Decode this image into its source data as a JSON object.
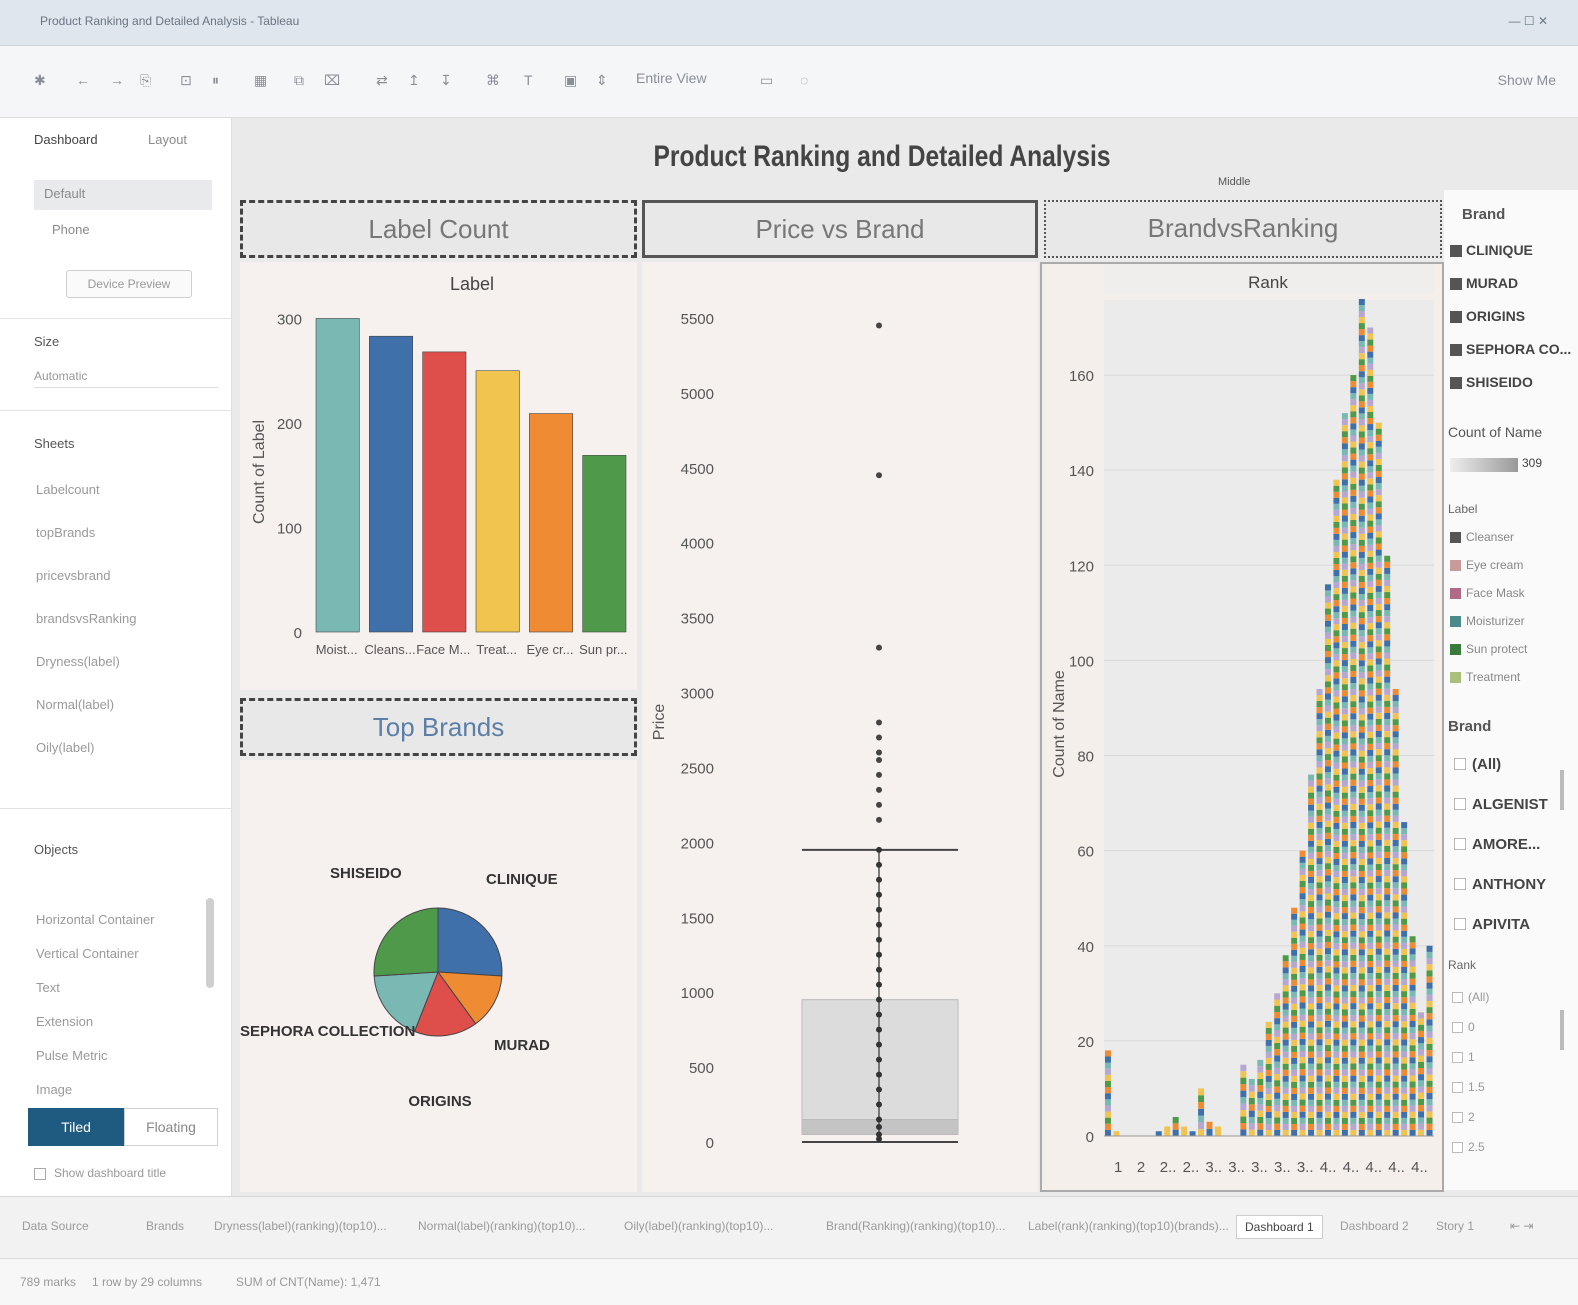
{
  "window": {
    "title": "Product Ranking and Detailed Analysis - Tableau",
    "controls": "— ☐ ✕"
  },
  "toolbar": {
    "icons": [
      "tableau-logo",
      "undo",
      "redo",
      "save",
      "new-data-source",
      "pause",
      "new-sheet",
      "duplicate",
      "clear",
      "swap",
      "sort-asc",
      "sort-desc",
      "group",
      "label",
      "format",
      "fit",
      "present"
    ],
    "fit_view": "Entire View",
    "show_me": "Show Me"
  },
  "left_pane": {
    "tabs": [
      "Dashboard",
      "Layout"
    ],
    "device_items": [
      "Default",
      "Phone"
    ],
    "device_preview": "Device Preview",
    "size_label": "Size",
    "size_value": "Automatic",
    "sheets_label": "Sheets",
    "sheets": [
      "Labelcount",
      "topBrands",
      "pricevsbrand",
      "brandsvsRanking",
      "Dryness(label)",
      "Normal(label)",
      "Oily(label)"
    ],
    "objects_label": "Objects",
    "objects": [
      "Horizontal Container",
      "Vertical Container",
      "Text",
      "Extension",
      "Pulse Metric",
      "Image"
    ],
    "layout_tiled": "Tiled",
    "layout_floating": "Floating",
    "show_title": "Show dashboard title"
  },
  "dashboard": {
    "title": "Product Ranking and Detailed Analysis",
    "label_count_header": "Label Count",
    "price_brand_header": "Price vs Brand",
    "brands_rank_header": "BrandvsRanking",
    "top_brands_header": "Top Brands",
    "brands_rank_small": "Middle"
  },
  "chart_data": [
    {
      "type": "bar",
      "title": "Label",
      "ylabel": "Count of Label",
      "ylim": [
        0,
        310
      ],
      "yticks": [
        "0",
        "100",
        "200",
        "300"
      ],
      "categories": [
        "Moist...",
        "Cleans...",
        "Face M...",
        "Treat...",
        "Eye cr...",
        "Sun pr..."
      ],
      "values": [
        300,
        283,
        268,
        250,
        209,
        169
      ],
      "colors": [
        "#7ab8b4",
        "#3f70aa",
        "#de4e4b",
        "#f1c44f",
        "#ef8b33",
        "#4f9a4a"
      ]
    },
    {
      "type": "pie",
      "title": "Top Brands",
      "categories": [
        "CLINIQUE",
        "MURAD",
        "ORIGINS",
        "SEPHORA COLLECTION",
        "SHISEIDO"
      ],
      "values": [
        26,
        14,
        16,
        18,
        26
      ],
      "colors": [
        "#3f70aa",
        "#ef8b33",
        "#de4e4b",
        "#7ab8b4",
        "#4f9a4a"
      ]
    },
    {
      "type": "scatter",
      "title": "Price vs Brand",
      "ylabel": "Price",
      "ylim": [
        0,
        5700
      ],
      "yticks": [
        "0",
        "500",
        "1000",
        "1500",
        "2000",
        "2500",
        "3000",
        "3500",
        "4000",
        "4500",
        "5000",
        "5500"
      ],
      "box": {
        "q1": 50,
        "median": 150,
        "q3": 950,
        "whisker_low": 0,
        "whisker_high": 1950
      },
      "outliers": [
        5450,
        4450,
        3300,
        2800,
        2700,
        2600,
        2550,
        2450,
        2350,
        2250,
        2150
      ],
      "dense": [
        1950,
        1850,
        1750,
        1650,
        1550,
        1450,
        1350,
        1250,
        1150,
        1050,
        950,
        850,
        750,
        650,
        550,
        450,
        350,
        250,
        150,
        100,
        50,
        20
      ]
    },
    {
      "type": "bar",
      "title": "Rank",
      "ylabel": "Count of Name",
      "ylim": [
        0,
        172
      ],
      "yticks": [
        "0",
        "20",
        "40",
        "60",
        "80",
        "100",
        "120",
        "140",
        "160",
        "180"
      ],
      "xticks": [
        "1",
        "2",
        "2..",
        "2..",
        "3..",
        "3..",
        "3..",
        "3..",
        "3..",
        "4..",
        "4..",
        "4..",
        "4..",
        "4.."
      ],
      "values": [
        18,
        1,
        0,
        0,
        0,
        0,
        1,
        2,
        4,
        2,
        1,
        10,
        3,
        2,
        0,
        0,
        15,
        12,
        16,
        24,
        30,
        38,
        48,
        60,
        76,
        94,
        116,
        138,
        152,
        160,
        176,
        170,
        150,
        122,
        94,
        66,
        42,
        26,
        40
      ],
      "colors": [
        "#3f70aa",
        "#ef8b33",
        "#4f9a4a",
        "#f1c44f",
        "#b7a6cf",
        "#7ab8b4"
      ]
    }
  ],
  "legend": {
    "brand_label": "Brand",
    "brands": [
      "CLINIQUE",
      "MURAD",
      "ORIGINS",
      "SEPHORA CO...",
      "SHISEIDO"
    ],
    "count_label": "Count of Name",
    "count_value": "309",
    "label_label": "Label",
    "labels": [
      "Cleanser",
      "Eye cream",
      "Face Mask",
      "Moisturizer",
      "Sun protect",
      "Treatment"
    ],
    "label_colors": [
      "#555555",
      "#c99a9a",
      "#b06a85",
      "#4a8a8a",
      "#3a7a3a",
      "#aac07a"
    ],
    "brand_filter_label": "Brand",
    "brand_filter": [
      "(All)",
      "ALGENIST",
      "AMORE...",
      "ANTHONY",
      "APIVITA"
    ],
    "rank_label": "Rank",
    "rank_filter": [
      "(All)",
      "0",
      "1",
      "1.5",
      "2",
      "2.5"
    ]
  },
  "bottom_tabs": [
    "Data Source",
    "Brands",
    "Dryness(label)(ranking)(top10)...",
    "Normal(label)(ranking)(top10)...",
    "Oily(label)(ranking)(top10)...",
    "Brand(Ranking)(ranking)(top10)...",
    "Label(rank)(ranking)(top10)(brands)...",
    "Dashboard 1",
    "Dashboard 2",
    "Story 1"
  ],
  "status": {
    "marks": "789 marks",
    "rows": "1 row by 29 columns",
    "sum": "SUM of CNT(Name): 1,471"
  }
}
